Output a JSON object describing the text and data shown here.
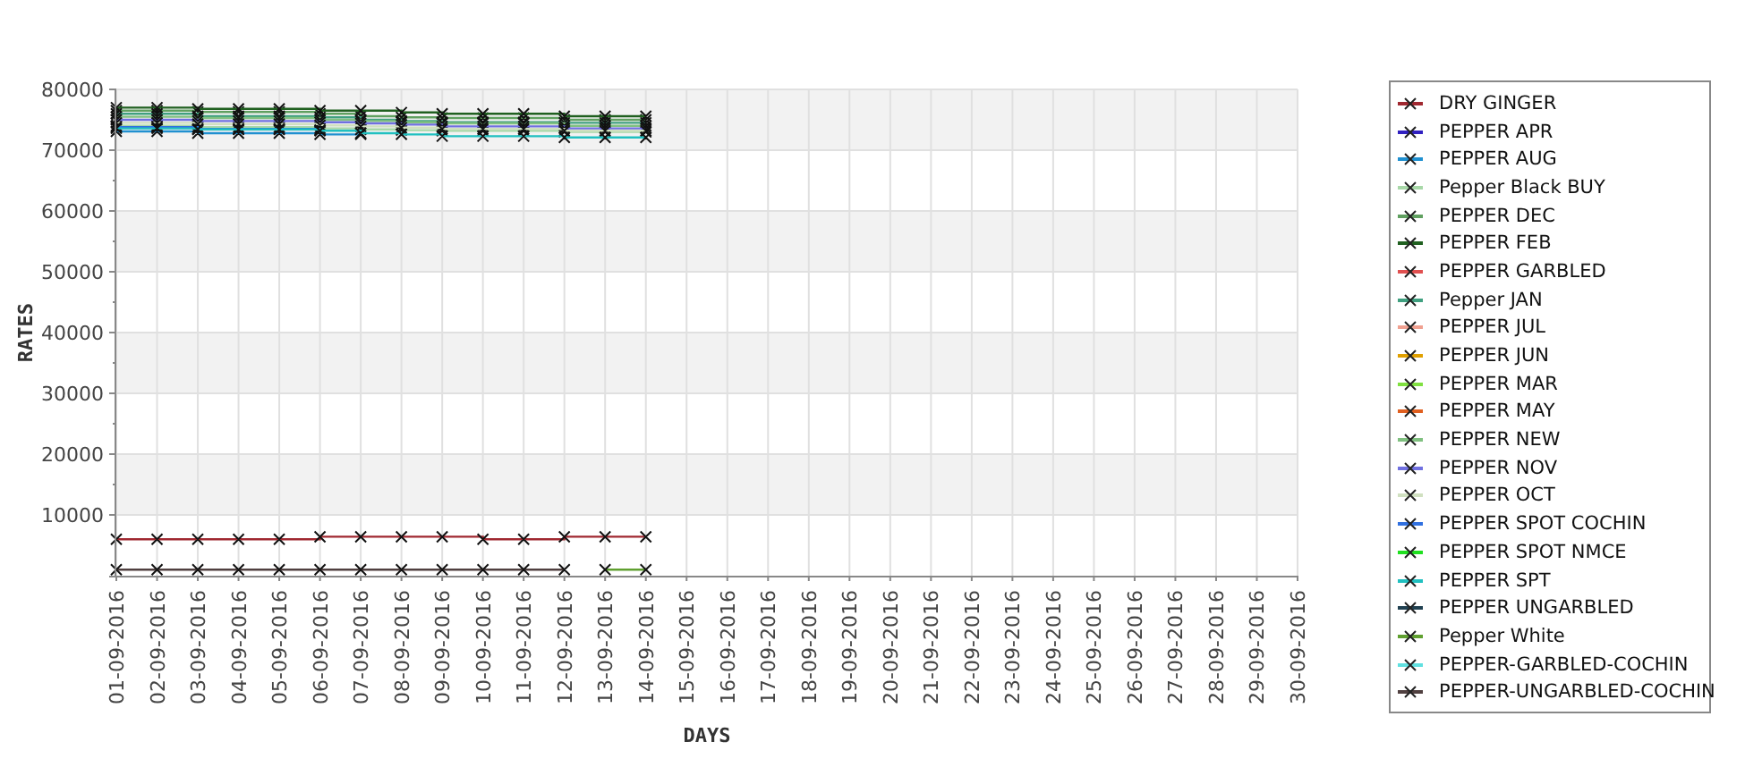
{
  "chart": {
    "chart_data": {
      "type": "line",
      "grid": true,
      "xlabel": "DAYS",
      "ylabel": "RATES",
      "categories": [
        "01-09-2016",
        "02-09-2016",
        "03-09-2016",
        "04-09-2016",
        "05-09-2016",
        "06-09-2016",
        "07-09-2016",
        "08-09-2016",
        "09-09-2016",
        "10-09-2016",
        "11-09-2016",
        "12-09-2016",
        "13-09-2016",
        "14-09-2016",
        "15-09-2016",
        "16-09-2016",
        "17-09-2016",
        "18-09-2016",
        "19-09-2016",
        "20-09-2016",
        "21-09-2016",
        "22-09-2016",
        "23-09-2016",
        "24-09-2016",
        "25-09-2016",
        "26-09-2016",
        "27-09-2016",
        "28-09-2016",
        "29-09-2016",
        "30-09-2016"
      ],
      "ylim": [
        0,
        80000
      ],
      "yticks": [
        10000,
        20000,
        30000,
        40000,
        50000,
        60000,
        70000,
        80000
      ],
      "series": [
        {
          "name": "DRY GINGER",
          "color": "#a02830",
          "marker": "x",
          "values": [
            6000,
            6000,
            6000,
            6000,
            6000,
            6400,
            6400,
            6400,
            6400,
            6000,
            6000,
            6400,
            6400,
            6400,
            null,
            null,
            null,
            null,
            null,
            null,
            null,
            null,
            null,
            null,
            null,
            null,
            null,
            null,
            null,
            null
          ]
        },
        {
          "name": "PEPPER APR",
          "color": "#3020c0",
          "values": [
            null,
            null,
            null,
            null,
            null,
            null,
            null,
            null,
            null,
            null,
            null,
            null,
            null,
            null,
            null,
            null,
            null,
            null,
            null,
            null,
            null,
            null,
            null,
            null,
            null,
            null,
            null,
            null,
            null,
            null
          ]
        },
        {
          "name": "PEPPER AUG",
          "color": "#2090d0",
          "marker": "x",
          "values": [
            73100,
            73100,
            72800,
            72800,
            72800,
            72600,
            72600,
            null,
            null,
            null,
            null,
            null,
            null,
            null,
            null,
            null,
            null,
            null,
            null,
            null,
            null,
            null,
            null,
            null,
            null,
            null,
            null,
            null,
            null,
            null
          ]
        },
        {
          "name": "Pepper Black BUY",
          "color": "#a8d8a8",
          "marker": "x",
          "values": [
            74000,
            74000,
            73800,
            73800,
            73800,
            73600,
            73400,
            73300,
            73200,
            73200,
            73200,
            73000,
            73000,
            73000,
            null,
            null,
            null,
            null,
            null,
            null,
            null,
            null,
            null,
            null,
            null,
            null,
            null,
            null,
            null,
            null
          ]
        },
        {
          "name": "PEPPER DEC",
          "color": "#60a060",
          "marker": "x",
          "values": [
            76500,
            76500,
            76300,
            76300,
            76300,
            76000,
            75600,
            75400,
            75300,
            75300,
            75300,
            75000,
            75000,
            75000,
            null,
            null,
            null,
            null,
            null,
            null,
            null,
            null,
            null,
            null,
            null,
            null,
            null,
            null,
            null,
            null
          ]
        },
        {
          "name": "PEPPER FEB",
          "color": "#206020",
          "marker": "x",
          "values": [
            77000,
            77000,
            76800,
            76800,
            76800,
            76500,
            76500,
            76200,
            76000,
            76000,
            76000,
            75600,
            75600,
            75600,
            null,
            null,
            null,
            null,
            null,
            null,
            null,
            null,
            null,
            null,
            null,
            null,
            null,
            null,
            null,
            null
          ]
        },
        {
          "name": "PEPPER GARBLED",
          "color": "#e05050",
          "values": [
            null,
            null,
            null,
            null,
            null,
            null,
            null,
            null,
            null,
            null,
            null,
            null,
            null,
            null,
            null,
            null,
            null,
            null,
            null,
            null,
            null,
            null,
            null,
            null,
            null,
            null,
            null,
            null,
            null,
            null
          ]
        },
        {
          "name": "Pepper JAN",
          "color": "#40a080",
          "marker": "x",
          "values": [
            76000,
            76000,
            75600,
            75600,
            75600,
            75400,
            75000,
            74800,
            74600,
            74600,
            74600,
            74500,
            74500,
            74500,
            null,
            null,
            null,
            null,
            null,
            null,
            null,
            null,
            null,
            null,
            null,
            null,
            null,
            null,
            null,
            null
          ]
        },
        {
          "name": "PEPPER JUL",
          "color": "#f0a090",
          "values": [
            null,
            null,
            null,
            null,
            null,
            null,
            null,
            null,
            null,
            null,
            null,
            null,
            null,
            null,
            null,
            null,
            null,
            null,
            null,
            null,
            null,
            null,
            null,
            null,
            null,
            null,
            null,
            null,
            null,
            null
          ]
        },
        {
          "name": "PEPPER JUN",
          "color": "#e0a000",
          "values": [
            null,
            null,
            null,
            null,
            null,
            null,
            null,
            null,
            null,
            null,
            null,
            null,
            null,
            null,
            null,
            null,
            null,
            null,
            null,
            null,
            null,
            null,
            null,
            null,
            null,
            null,
            null,
            null,
            null,
            null
          ]
        },
        {
          "name": "PEPPER MAR",
          "color": "#80e040",
          "values": [
            null,
            null,
            null,
            null,
            null,
            null,
            null,
            null,
            null,
            null,
            null,
            null,
            null,
            null,
            null,
            null,
            null,
            null,
            null,
            null,
            null,
            null,
            null,
            null,
            null,
            null,
            null,
            null,
            null,
            null
          ]
        },
        {
          "name": "PEPPER MAY",
          "color": "#e06020",
          "values": [
            null,
            null,
            null,
            null,
            null,
            null,
            null,
            null,
            null,
            null,
            null,
            null,
            null,
            null,
            null,
            null,
            null,
            null,
            null,
            null,
            null,
            null,
            null,
            null,
            null,
            null,
            null,
            null,
            null,
            null
          ]
        },
        {
          "name": "PEPPER NEW",
          "color": "#80c080",
          "marker": "x",
          "values": [
            75500,
            75500,
            75300,
            75300,
            75300,
            75000,
            74800,
            74600,
            74400,
            74400,
            74400,
            74000,
            74000,
            74000,
            null,
            null,
            null,
            null,
            null,
            null,
            null,
            null,
            null,
            null,
            null,
            null,
            null,
            null,
            null,
            null
          ]
        },
        {
          "name": "PEPPER NOV",
          "color": "#7070e0",
          "marker": "x",
          "values": [
            75000,
            75000,
            74800,
            74800,
            74800,
            74600,
            74400,
            74200,
            73900,
            73900,
            73900,
            73600,
            73600,
            73600,
            null,
            null,
            null,
            null,
            null,
            null,
            null,
            null,
            null,
            null,
            null,
            null,
            null,
            null,
            null,
            null
          ]
        },
        {
          "name": "PEPPER OCT",
          "color": "#d0e0c0",
          "marker": "x",
          "values": [
            74500,
            74500,
            74300,
            74300,
            74300,
            74100,
            73900,
            73700,
            73500,
            73500,
            73500,
            73200,
            73200,
            73200,
            null,
            null,
            null,
            null,
            null,
            null,
            null,
            null,
            null,
            null,
            null,
            null,
            null,
            null,
            null,
            null
          ]
        },
        {
          "name": "PEPPER SPOT COCHIN",
          "color": "#3070e0",
          "marker": "x",
          "values": [
            73800,
            73800,
            73500,
            73500,
            73500,
            73300,
            null,
            null,
            null,
            null,
            null,
            null,
            null,
            null,
            null,
            null,
            null,
            null,
            null,
            null,
            null,
            null,
            null,
            null,
            null,
            null,
            null,
            null,
            null,
            null
          ]
        },
        {
          "name": "PEPPER SPOT NMCE",
          "color": "#20e020",
          "values": [
            null,
            null,
            null,
            null,
            null,
            null,
            null,
            null,
            null,
            null,
            null,
            null,
            null,
            null,
            null,
            null,
            null,
            null,
            null,
            null,
            null,
            null,
            null,
            null,
            null,
            null,
            null,
            null,
            null,
            null
          ]
        },
        {
          "name": "PEPPER SPT",
          "color": "#20c0c0",
          "marker": "x",
          "values": [
            73600,
            73600,
            73400,
            73400,
            73400,
            73200,
            72800,
            72600,
            72300,
            72300,
            72300,
            72100,
            72100,
            72100,
            null,
            null,
            null,
            null,
            null,
            null,
            null,
            null,
            null,
            null,
            null,
            null,
            null,
            null,
            null,
            null
          ]
        },
        {
          "name": "PEPPER UNGARBLED",
          "color": "#204050",
          "values": [
            null,
            null,
            null,
            null,
            null,
            null,
            null,
            null,
            null,
            null,
            null,
            null,
            null,
            null,
            null,
            null,
            null,
            null,
            null,
            null,
            null,
            null,
            null,
            null,
            null,
            null,
            null,
            null,
            null,
            null
          ]
        },
        {
          "name": "Pepper White",
          "color": "#60a030",
          "marker": "x",
          "values": [
            null,
            null,
            null,
            null,
            null,
            null,
            null,
            null,
            null,
            null,
            null,
            null,
            1000,
            1000,
            null,
            null,
            null,
            null,
            null,
            null,
            null,
            null,
            null,
            null,
            null,
            null,
            null,
            null,
            null,
            null
          ]
        },
        {
          "name": "PEPPER-GARBLED-COCHIN",
          "color": "#60e0e0",
          "values": [
            null,
            null,
            null,
            null,
            null,
            null,
            null,
            null,
            null,
            null,
            null,
            null,
            null,
            null,
            null,
            null,
            null,
            null,
            null,
            null,
            null,
            null,
            null,
            null,
            null,
            null,
            null,
            null,
            null,
            null
          ]
        },
        {
          "name": "PEPPER-UNGARBLED-COCHIN",
          "color": "#504040",
          "marker": "x",
          "values": [
            1000,
            1000,
            1000,
            1000,
            1000,
            1000,
            1000,
            1000,
            1000,
            1000,
            1000,
            1000,
            null,
            null,
            null,
            null,
            null,
            null,
            null,
            null,
            null,
            null,
            null,
            null,
            null,
            null,
            null,
            null,
            null,
            null
          ]
        }
      ]
    }
  }
}
